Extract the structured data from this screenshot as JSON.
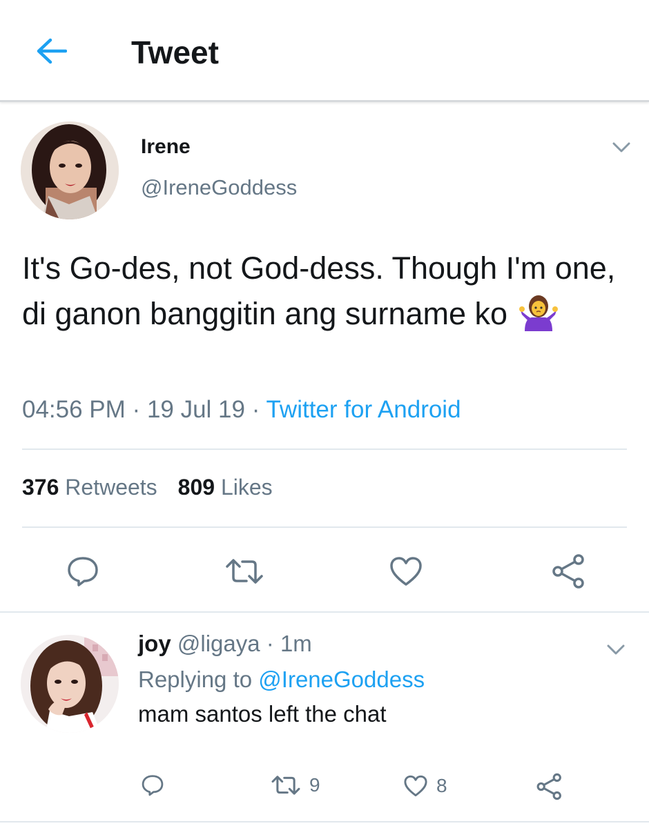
{
  "header": {
    "title": "Tweet"
  },
  "tweet": {
    "author_name": "Irene",
    "author_handle": "@IreneGoddess",
    "text": "It's Go-des, not God-dess. Though I'm one, di ganon banggitin ang surname ko",
    "emoji_icon": "person-shrugging-emoji",
    "time": "04:56 PM",
    "date": "19 Jul 19",
    "separator": "·",
    "source": "Twitter for Android",
    "retweets_count": "376",
    "retweets_label": "Retweets",
    "likes_count": "809",
    "likes_label": "Likes"
  },
  "reply": {
    "name": "joy",
    "handle": "@ligaya",
    "separator": "·",
    "time": "1m",
    "replying_label": "Replying to",
    "replying_to": "@IreneGoddess",
    "text": "mam santos left the chat",
    "retweet_count": "9",
    "like_count": "8"
  },
  "colors": {
    "accent": "#1da1f2",
    "text_primary": "#14171a",
    "text_secondary": "#657786",
    "icon": "#657786",
    "divider": "#e1e8ed"
  }
}
